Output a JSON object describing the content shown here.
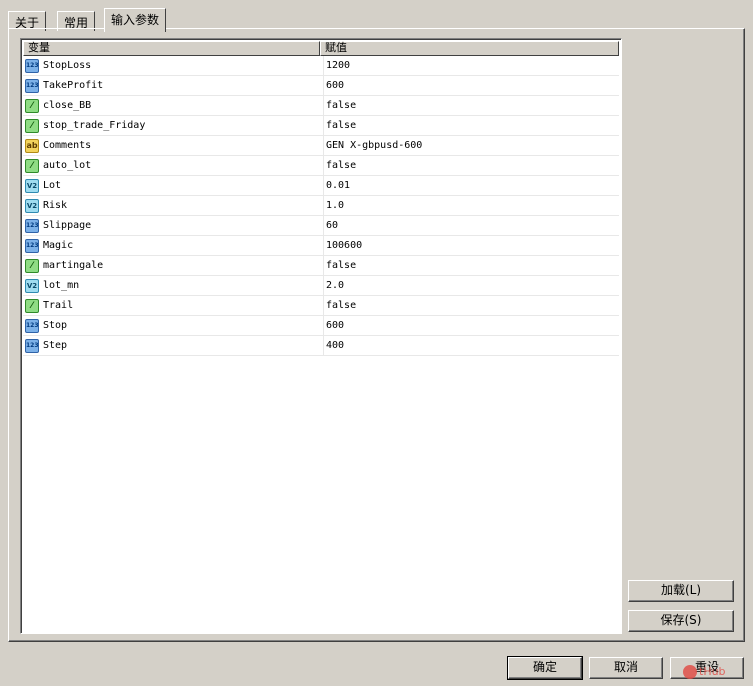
{
  "tabs": [
    "关于",
    "常用",
    "输入参数"
  ],
  "active_tab": 2,
  "grid": {
    "columns": [
      "变量",
      "赋值"
    ],
    "rows": [
      {
        "icon": "int-icon",
        "name": "StopLoss",
        "value": "1200"
      },
      {
        "icon": "int-icon",
        "name": "TakeProfit",
        "value": "600"
      },
      {
        "icon": "bool-icon",
        "name": "close_BB",
        "value": "false"
      },
      {
        "icon": "bool-icon",
        "name": "stop_trade_Friday",
        "value": "false"
      },
      {
        "icon": "string-icon",
        "name": "Comments",
        "value": "GEN X-gbpusd-600"
      },
      {
        "icon": "bool-icon",
        "name": "auto_lot",
        "value": "false"
      },
      {
        "icon": "double-icon",
        "name": "Lot",
        "value": "0.01"
      },
      {
        "icon": "double-icon",
        "name": "Risk",
        "value": "1.0"
      },
      {
        "icon": "int-icon",
        "name": "Slippage",
        "value": "60"
      },
      {
        "icon": "int-icon",
        "name": "Magic",
        "value": "100600"
      },
      {
        "icon": "bool-icon",
        "name": "martingale",
        "value": "false"
      },
      {
        "icon": "double-icon",
        "name": "lot_mn",
        "value": "2.0"
      },
      {
        "icon": "bool-icon",
        "name": "Trail",
        "value": "false"
      },
      {
        "icon": "int-icon",
        "name": "Stop",
        "value": "600"
      },
      {
        "icon": "int-icon",
        "name": "Step",
        "value": "400"
      }
    ]
  },
  "side_buttons": {
    "load": "加载(L)",
    "save": "保存(S)"
  },
  "footer": {
    "ok": "确定",
    "cancel": "取消",
    "reset": "重设"
  },
  "icon_glyphs": {
    "int-icon": "123",
    "bool-icon": "⁄",
    "string-icon": "ab",
    "double-icon": "V2"
  },
  "watermark": "tHub"
}
